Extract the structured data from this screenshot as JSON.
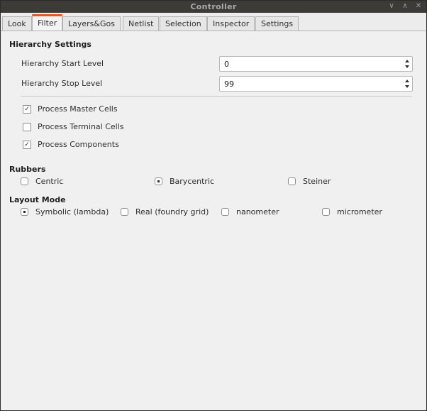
{
  "window": {
    "title": "Controller",
    "icons": [
      "chevron-down-icon",
      "chevron-up-icon",
      "close-icon"
    ],
    "accent_color": "#e95420"
  },
  "tabs": [
    {
      "label": "Look",
      "active": false
    },
    {
      "label": "Filter",
      "active": true
    },
    {
      "label": "Layers&Gos",
      "active": false
    },
    {
      "label": "Netlist",
      "active": false
    },
    {
      "label": "Selection",
      "active": false
    },
    {
      "label": "Inspector",
      "active": false
    },
    {
      "label": "Settings",
      "active": false
    }
  ],
  "hierarchy": {
    "heading": "Hierarchy Settings",
    "start_label": "Hierarchy Start Level",
    "start_value": "0",
    "stop_label": "Hierarchy Stop Level",
    "stop_value": "99"
  },
  "process": {
    "master_cells": {
      "label": "Process Master Cells",
      "checked": true
    },
    "terminal_cells": {
      "label": "Process Terminal Cells",
      "checked": false
    },
    "components": {
      "label": "Process Components",
      "checked": true
    }
  },
  "rubbers": {
    "heading": "Rubbers",
    "options": [
      {
        "label": "Centric",
        "selected": false
      },
      {
        "label": "Barycentric",
        "selected": true
      },
      {
        "label": "Steiner",
        "selected": false
      }
    ]
  },
  "layout_mode": {
    "heading": "Layout Mode",
    "options": [
      {
        "label": "Symbolic (lambda)",
        "selected": true
      },
      {
        "label": "Real (foundry grid)",
        "selected": false
      },
      {
        "label": "nanometer",
        "selected": false
      },
      {
        "label": "micrometer",
        "selected": false
      }
    ]
  }
}
